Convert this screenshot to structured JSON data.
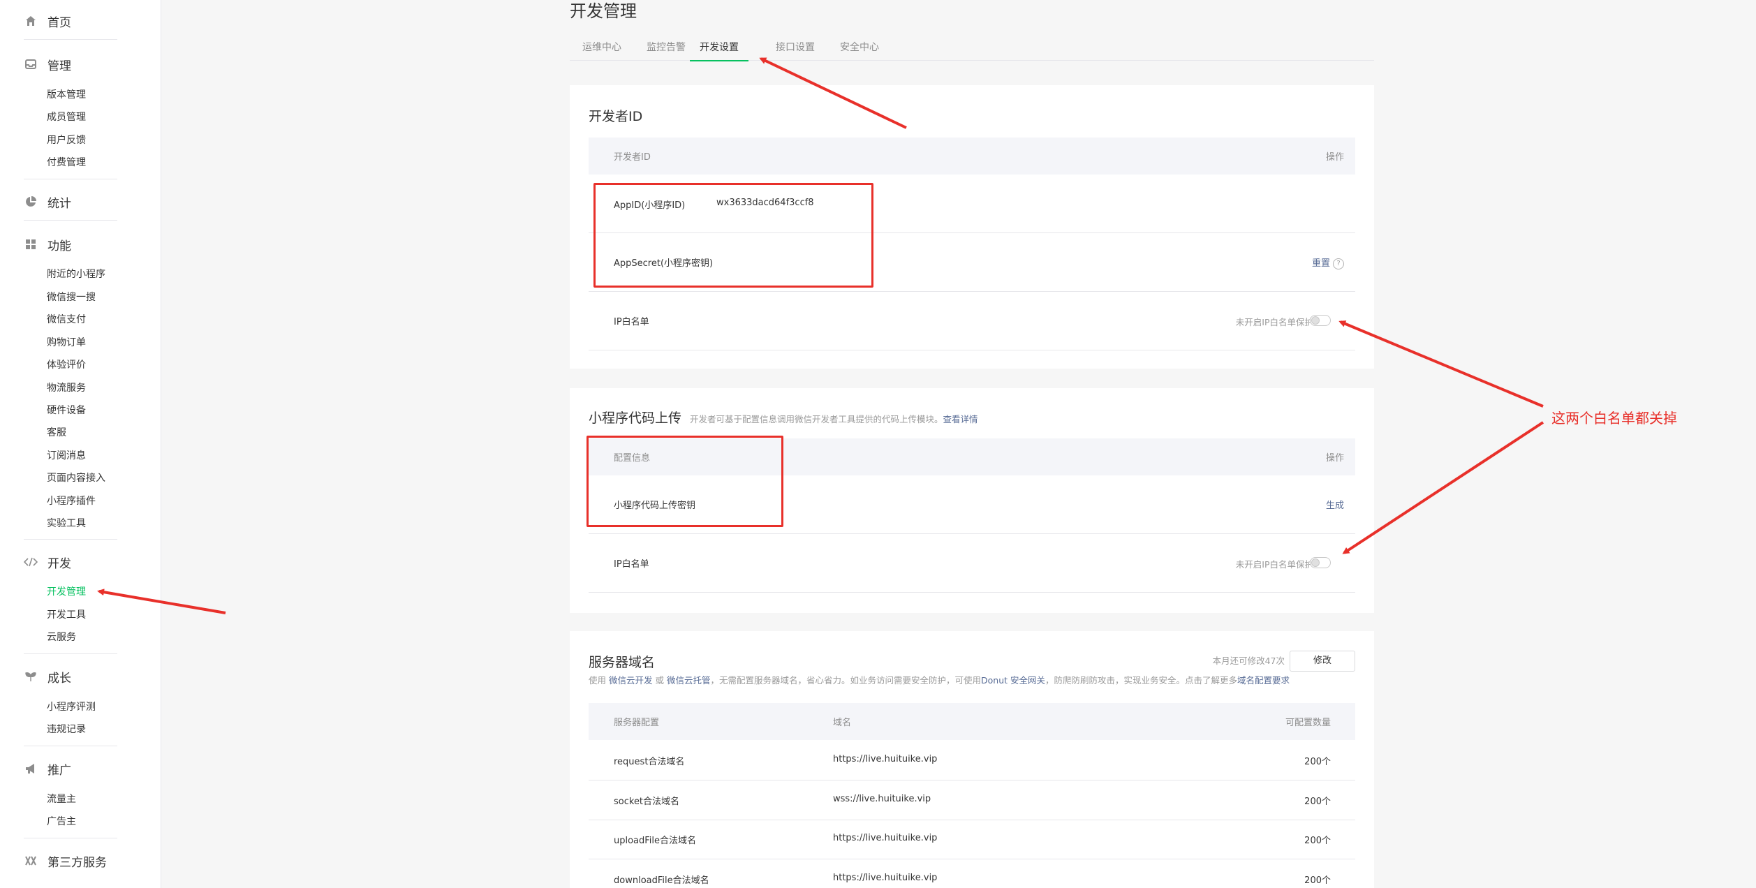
{
  "sidebar": {
    "home": "首页",
    "manage": {
      "title": "管理",
      "items": [
        "版本管理",
        "成员管理",
        "用户反馈",
        "付费管理"
      ]
    },
    "stats": "统计",
    "features": {
      "title": "功能",
      "items": [
        "附近的小程序",
        "微信搜一搜",
        "微信支付",
        "购物订单",
        "体验评价",
        "物流服务",
        "硬件设备",
        "客服",
        "订阅消息",
        "页面内容接入",
        "小程序插件",
        "实验工具"
      ]
    },
    "dev": {
      "title": "开发",
      "items": [
        "开发管理",
        "开发工具",
        "云服务"
      ]
    },
    "growth": {
      "title": "成长",
      "items": [
        "小程序评测",
        "违规记录"
      ]
    },
    "promo": {
      "title": "推广",
      "items": [
        "流量主",
        "广告主"
      ]
    },
    "third": "第三方服务"
  },
  "page": {
    "title": "开发管理",
    "tabs": [
      "运维中心",
      "监控告警",
      "开发设置",
      "接口设置",
      "安全中心"
    ],
    "active_tab": "开发设置"
  },
  "developer_id": {
    "title": "开发者ID",
    "col_left": "开发者ID",
    "col_right": "操作",
    "appid_label": "AppID(小程序ID)",
    "appid_value": "wx3633dacd64f3ccf8",
    "secret_label": "AppSecret(小程序密钥)",
    "reset": "重置",
    "help": "?",
    "ip_label": "IP白名单",
    "ip_status": "未开启IP白名单保护"
  },
  "upload": {
    "title": "小程序代码上传",
    "desc": "开发者可基于配置信息调用微信开发者工具提供的代码上传模块。",
    "desc_link": "查看详情",
    "col_left": "配置信息",
    "col_right": "操作",
    "key_label": "小程序代码上传密钥",
    "generate": "生成",
    "ip_label": "IP白名单",
    "ip_status": "未开启IP白名单保护"
  },
  "server": {
    "title": "服务器域名",
    "remaining": "本月还可修改47次",
    "modify": "修改",
    "desc_a": "使用",
    "link_a": "微信云开发",
    "desc_b": "或",
    "link_b": "微信云托管",
    "desc_c": "，无需配置服务器域名，省心省力。如业务访问需要安全防护，可使用",
    "link_c": "Donut 安全网关",
    "desc_d": "，防爬防刷防攻击，实现业务安全。点击了解更多",
    "link_d": "域名配置要求",
    "cols": [
      "服务器配置",
      "域名",
      "可配置数量"
    ],
    "rows": [
      {
        "name": "request合法域名",
        "domain": "https://live.huituike.vip",
        "count": "200个"
      },
      {
        "name": "socket合法域名",
        "domain": "wss://live.huituike.vip",
        "count": "200个"
      },
      {
        "name": "uploadFile合法域名",
        "domain": "https://live.huituike.vip",
        "count": "200个"
      },
      {
        "name": "downloadFile合法域名",
        "domain": "https://live.huituike.vip",
        "count": "200个"
      }
    ]
  },
  "annotation": "这两个白名单都关掉",
  "colors": {
    "accent": "#07c160",
    "link": "#576b95",
    "annotation": "#e8302a"
  }
}
